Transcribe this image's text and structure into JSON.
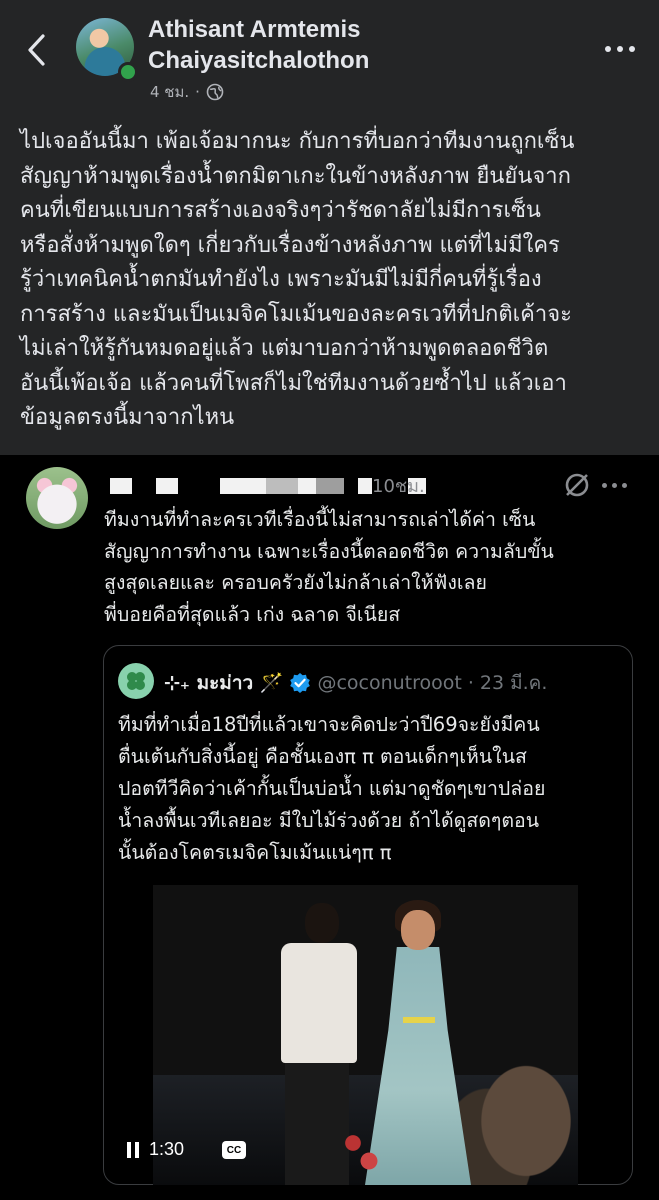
{
  "post": {
    "author_name_line1": "Athisant Armtemis",
    "author_name_line2": "Chaiyasitchalothon",
    "time": "4 ชม.",
    "separator": "·",
    "body_lines": [
      "ไปเจออันนี้มา เพ้อเจ้อมากนะ กับการที่บอกว่าทีมงานถูกเซ็น",
      "สัญญาห้ามพูดเรื่องน้ำตกมิตาเกะในข้างหลังภาพ ยืนยันจาก",
      "คนที่เขียนแบบการสร้างเองจริงๆว่ารัชดาลัยไม่มีการเซ็น",
      "หรือสั่งห้ามพูดใดๆ เกี่ยวกับเรื่องข้างหลังภาพ แต่ที่ไม่มีใคร",
      "รู้ว่าเทคนิคน้ำตกมันทำยังไง เพราะมันมีไม่มีกี่คนที่รู้เรื่อง",
      "การสร้าง และมันเป็นเมจิคโมเม้นของละครเวทีที่ปกติเค้าจะ",
      "ไม่เล่าให้รู้กันหมดอยู่แล้ว แต่มาบอกว่าห้ามพูดตลอดชีวิต",
      "อันนี้เพ้อเจ้อ แล้วคนที่โพสก็ไม่ใช่ทีมงานด้วยซ้ำไป แล้วเอา",
      "ข้อมูลตรงนี้มาจากไหน"
    ]
  },
  "reply": {
    "time": "10ชม.",
    "text_lines": [
      "ทีมงานที่ทำละครเวทีเรื่องนี้ไม่สามารถเล่าได้ค่า เซ็น",
      "สัญญาการทำงาน เฉพาะเรื่องนี้ตลอดชีวิต ความลับขั้น",
      "สูงสุดเลยและ ครอบครัวยังไม่กล้าเล่าให้ฟังเลย",
      "พี่บอยคือที่สุดแล้ว เก่ง ฉลาด จีเนียส"
    ]
  },
  "quoted_tweet": {
    "display_name": "⊹₊ มะม่าว 🪄",
    "handle": "@coconutrooot",
    "separator": "·",
    "date": "23 มี.ค.",
    "text_lines": [
      "ทีมที่ทำเมื่อ18ปีที่แล้วเขาจะคิดปะว่าปี69จะยังมีคน",
      "ตื่นเต้นกับสิ่งนี้อยู่ คือชั้นเองπ π ตอนเด็กๆเห็นในส",
      "ปอตทีวีคิดว่าเค้ากั้นเป็นบ่อน้ำ แต่มาดูชัดๆเขาปล่อย",
      "น้ำลงพื้นเวทีเลยอะ มีใบไม้ร่วงด้วย ถ้าได้ดูสดๆตอน",
      "นั้นต้องโคตรเมจิคโมเม้นแน่ๆπ π"
    ]
  },
  "video": {
    "time": "1:30",
    "cc_label": "CC"
  },
  "colors": {
    "post_bg": "#242526",
    "page_bg": "#000000",
    "verified": "#1d9bf0",
    "online": "#31a24c"
  },
  "icons": [
    "back-chevron-icon",
    "globe-icon",
    "more-horizontal-icon",
    "pause-icon",
    "verified-badge-icon",
    "closed-captions-icon"
  ]
}
